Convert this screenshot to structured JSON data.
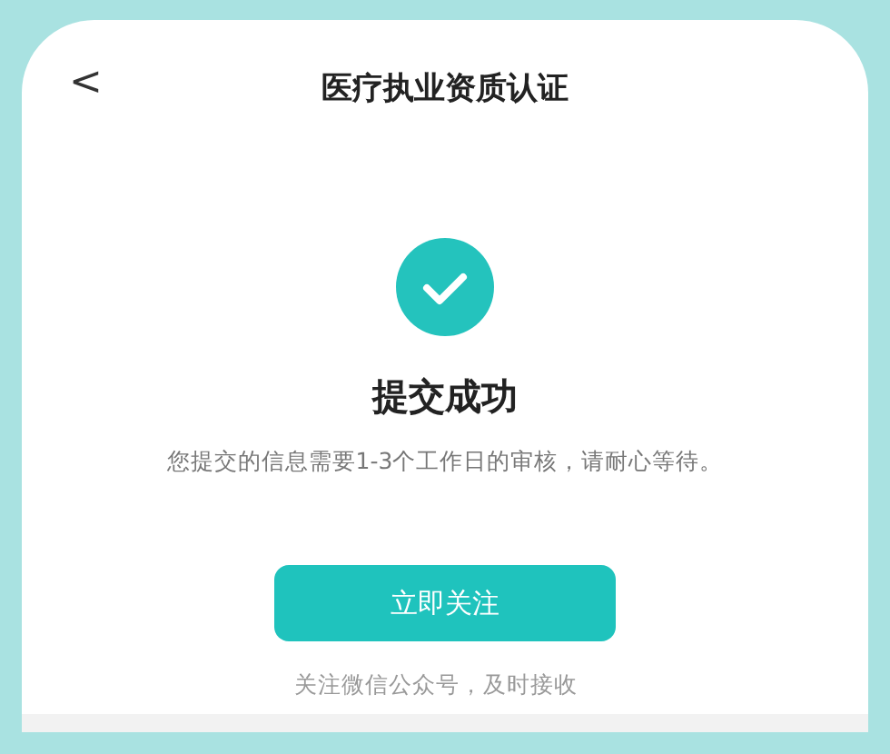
{
  "nav": {
    "back": "<",
    "title": "医疗执业资质认证"
  },
  "result": {
    "kind": "success",
    "title": "提交成功",
    "message": "您提交的信息需要1-3个工作日的审核，请耐心等待。"
  },
  "follow_button": "立即关注",
  "footer_note": "关注微信公众号，及时接收"
}
